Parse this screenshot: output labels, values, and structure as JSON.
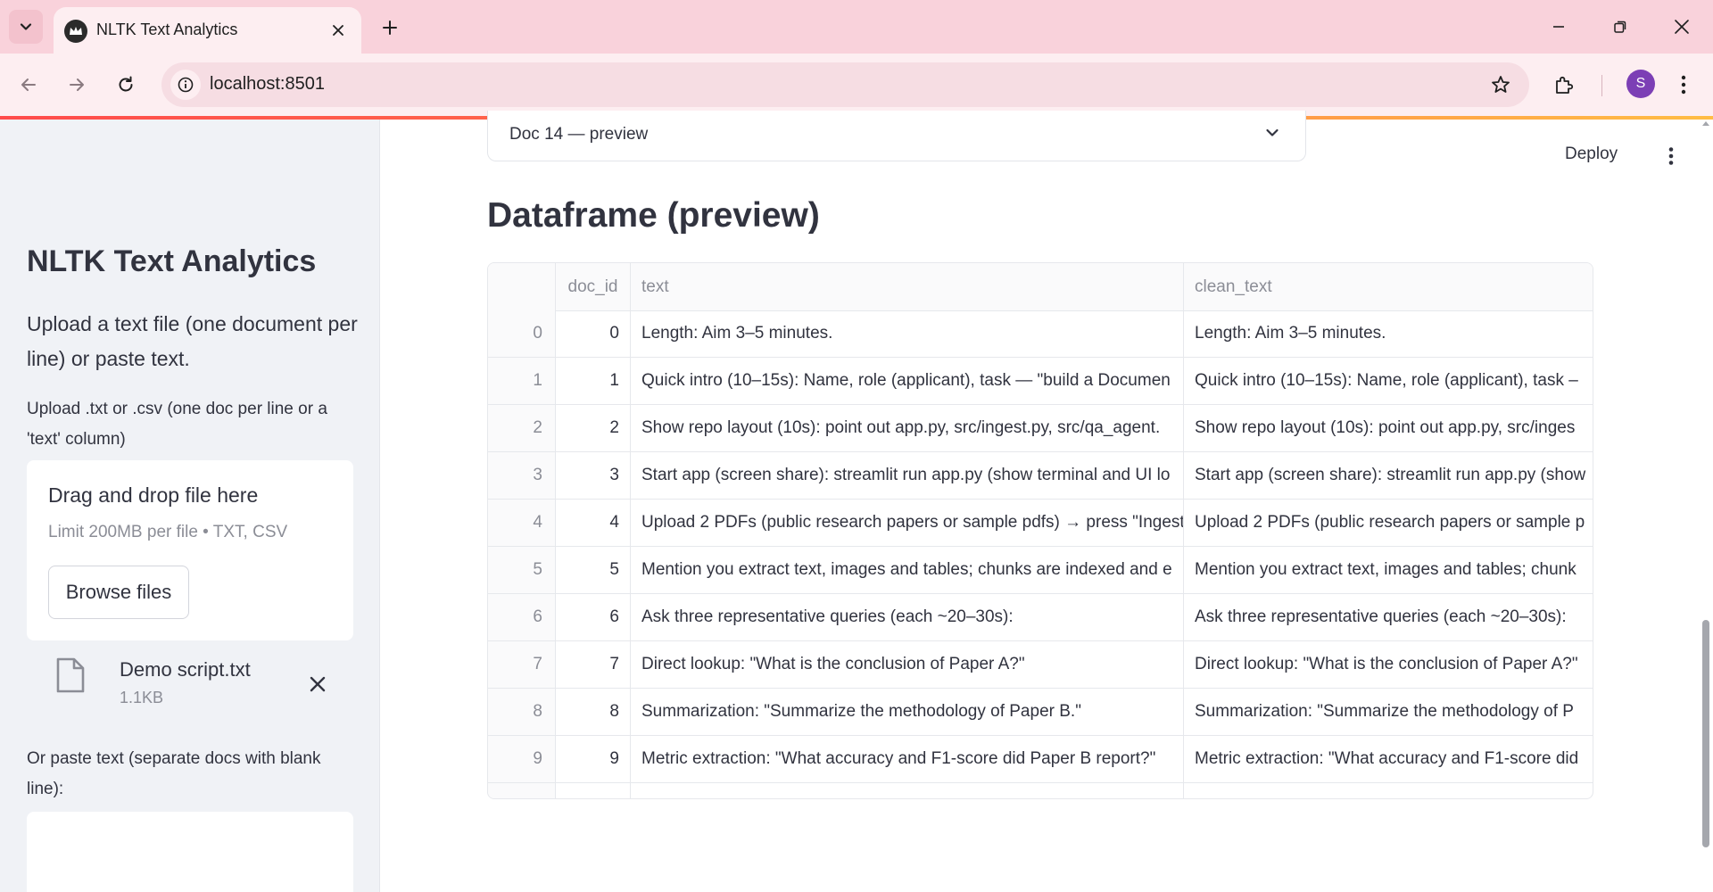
{
  "browser": {
    "tab_title": "NLTK Text Analytics",
    "url": "localhost:8501",
    "profile_initial": "S"
  },
  "sidebar": {
    "title": "NLTK Text Analytics",
    "intro": "Upload a text file (one document per line) or paste text.",
    "upload_label": "Upload .txt or .csv (one doc per line or a 'text' column)",
    "dropzone_title": "Drag and drop file here",
    "dropzone_limit": "Limit 200MB per file • TXT, CSV",
    "browse_label": "Browse files",
    "uploaded_file": {
      "name": "Demo script.txt",
      "size": "1.1KB"
    },
    "paste_label": "Or paste text (separate docs with blank line):"
  },
  "main": {
    "expander_label": "Doc 14 — preview",
    "deploy_label": "Deploy",
    "heading": "Dataframe (preview)",
    "table": {
      "columns": [
        "",
        "doc_id",
        "text",
        "clean_text"
      ],
      "rows": [
        {
          "idx": "0",
          "doc_id": "0",
          "text": "Length: Aim 3–5 minutes.",
          "clean_text": "Length: Aim 3–5 minutes."
        },
        {
          "idx": "1",
          "doc_id": "1",
          "text": "Quick intro (10–15s): Name, role (applicant), task — \"build a Documen",
          "clean_text": "Quick intro (10–15s): Name, role (applicant), task –"
        },
        {
          "idx": "2",
          "doc_id": "2",
          "text": "Show repo layout (10s): point out app.py, src/ingest.py, src/qa_agent.",
          "clean_text": "Show repo layout (10s): point out app.py, src/inges"
        },
        {
          "idx": "3",
          "doc_id": "3",
          "text": "Start app (screen share): streamlit run app.py (show terminal and UI lo",
          "clean_text": "Start app (screen share): streamlit run app.py (show"
        },
        {
          "idx": "4",
          "doc_id": "4",
          "text": "Upload 2 PDFs (public research papers or sample pdfs) → press \"Ingest",
          "clean_text": "Upload 2 PDFs (public research papers or sample p"
        },
        {
          "idx": "5",
          "doc_id": "5",
          "text": "Mention you extract text, images and tables; chunks are indexed and e",
          "clean_text": "Mention you extract text, images and tables; chunk"
        },
        {
          "idx": "6",
          "doc_id": "6",
          "text": "Ask three representative queries (each ~20–30s):",
          "clean_text": "Ask three representative queries (each ~20–30s):"
        },
        {
          "idx": "7",
          "doc_id": "7",
          "text": "Direct lookup: \"What is the conclusion of Paper A?\"",
          "clean_text": "Direct lookup: \"What is the conclusion of Paper A?\""
        },
        {
          "idx": "8",
          "doc_id": "8",
          "text": "Summarization: \"Summarize the methodology of Paper B.\"",
          "clean_text": "Summarization: \"Summarize the methodology of P"
        },
        {
          "idx": "9",
          "doc_id": "9",
          "text": "Metric extraction: \"What accuracy and F1-score did Paper B report?\"",
          "clean_text": "Metric extraction: \"What accuracy and F1-score did"
        }
      ]
    }
  },
  "icons": {
    "tab_list": "chevron-down-icon",
    "favicon": "streamlit-crown-icon",
    "tab_close": "close-icon",
    "new_tab": "plus-icon",
    "back": "arrow-left-icon",
    "forward": "arrow-right-icon",
    "reload": "reload-icon",
    "site_info": "info-icon",
    "bookmark": "star-icon",
    "extensions": "puzzle-icon",
    "menu": "kebab-icon",
    "file": "file-icon"
  },
  "colors": {
    "tabbar_bg": "#f9d2db",
    "toolbar_bg": "#fdeef1",
    "sidebar_bg": "#f0f2f6",
    "accent_red": "#ff4b4b",
    "avatar_bg": "#7c3fb5",
    "text": "#31333f",
    "muted": "#8b8d96"
  }
}
